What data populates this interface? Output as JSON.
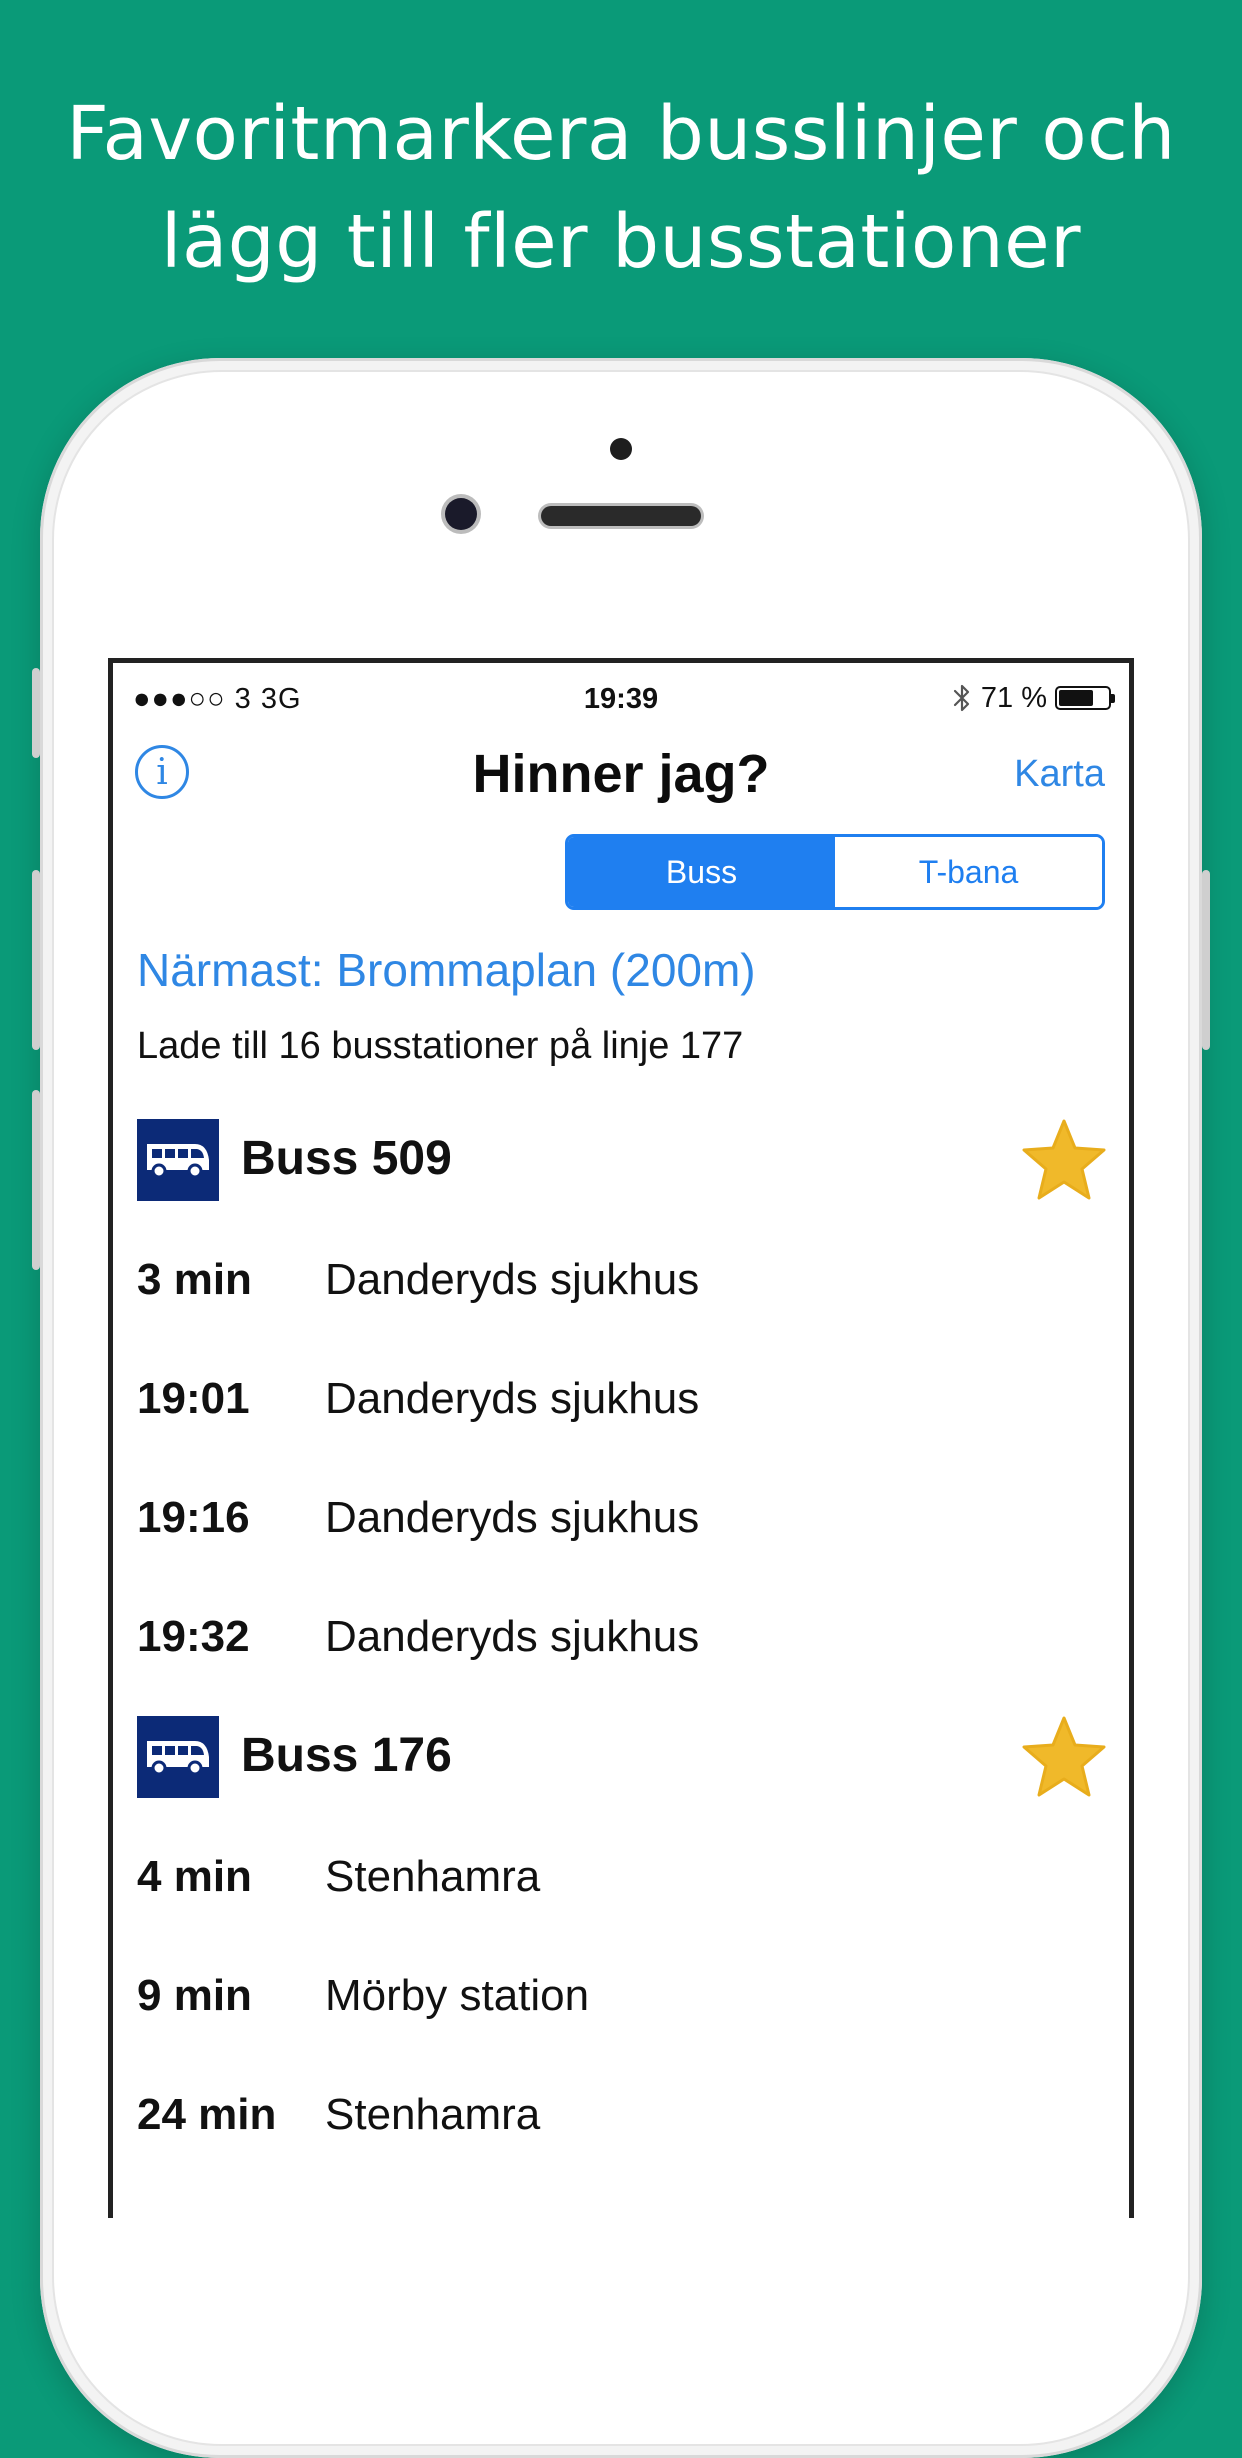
{
  "promo": {
    "line1": "Favoritmarkera busslinjer och",
    "line2": "lägg till fler busstationer"
  },
  "status_bar": {
    "carrier": "●●●○○ 3   3G",
    "time": "19:39",
    "battery": "71 %",
    "battery_level": 0.71
  },
  "nav": {
    "info_glyph": "i",
    "title": "Hinner jag?",
    "right_button": "Karta"
  },
  "segmented": {
    "options": [
      "Buss",
      "T-bana"
    ],
    "selected": "Buss"
  },
  "nearest": "Närmast: Brommaplan (200m)",
  "notice": "Lade till 16 busstationer på linje 177",
  "lines": [
    {
      "name": "Buss 509",
      "favorite": true,
      "departures": [
        {
          "time": "3 min",
          "destination": "Danderyds sjukhus"
        },
        {
          "time": "19:01",
          "destination": "Danderyds sjukhus"
        },
        {
          "time": "19:16",
          "destination": "Danderyds sjukhus"
        },
        {
          "time": "19:32",
          "destination": "Danderyds sjukhus"
        }
      ]
    },
    {
      "name": "Buss 176",
      "favorite": true,
      "departures": [
        {
          "time": "4 min",
          "destination": "Stenhamra"
        },
        {
          "time": "9 min",
          "destination": "Mörby station"
        },
        {
          "time": "24 min",
          "destination": "Stenhamra"
        }
      ]
    }
  ],
  "colors": {
    "background": "#0a9a78",
    "accent": "#2f87e4",
    "segment_blue": "#1f7ff0",
    "bus_icon_bg": "#0c2a77",
    "star": "#f0b92a"
  },
  "icons": {
    "bus": "bus-icon",
    "star": "star-icon",
    "info": "info-icon",
    "bluetooth": "bluetooth-icon",
    "battery": "battery-icon"
  }
}
